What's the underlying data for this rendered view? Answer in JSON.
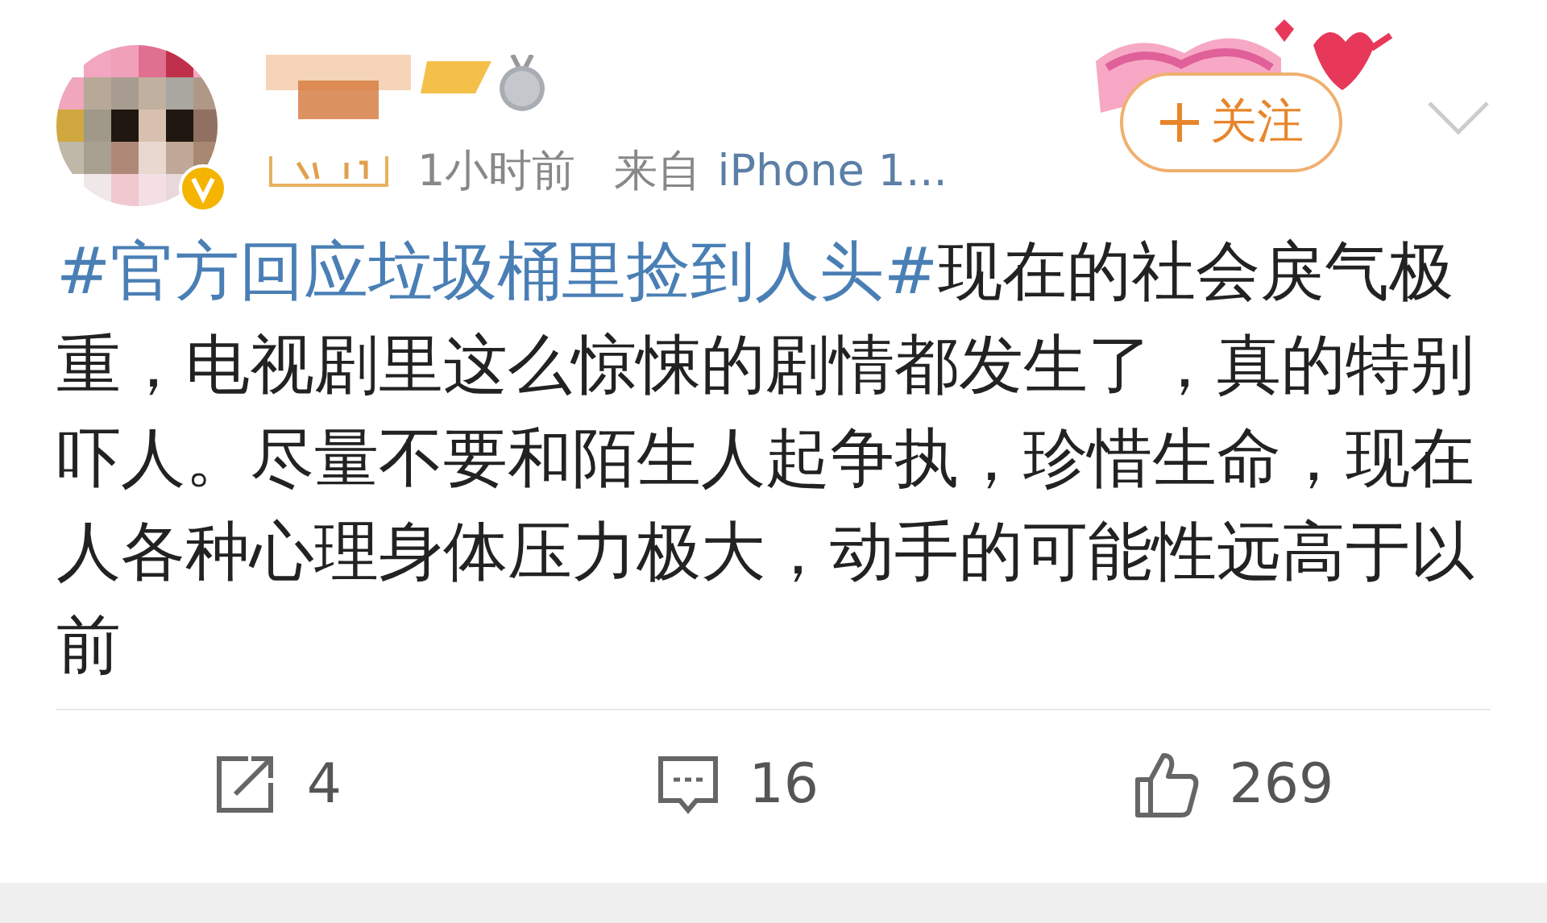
{
  "post": {
    "header": {
      "time": "1小时前",
      "source_prefix": "来自",
      "source": "iPhone 1...",
      "verified": true,
      "follow_button": {
        "label": "关注"
      }
    },
    "hashtag": "#官方回应垃圾桶里捡到人头#",
    "text": "现在的社会戾气极重，电视剧里这么惊悚的剧情都发生了，真的特别吓人。尽量不要和陌生人起争执，珍惜生命，现在人各种心理身体压力极大，动手的可能性远高于以前",
    "actions": [
      {
        "kind": "repost",
        "count": "4"
      },
      {
        "kind": "comment",
        "count": "16"
      },
      {
        "kind": "like",
        "count": "269"
      }
    ]
  }
}
